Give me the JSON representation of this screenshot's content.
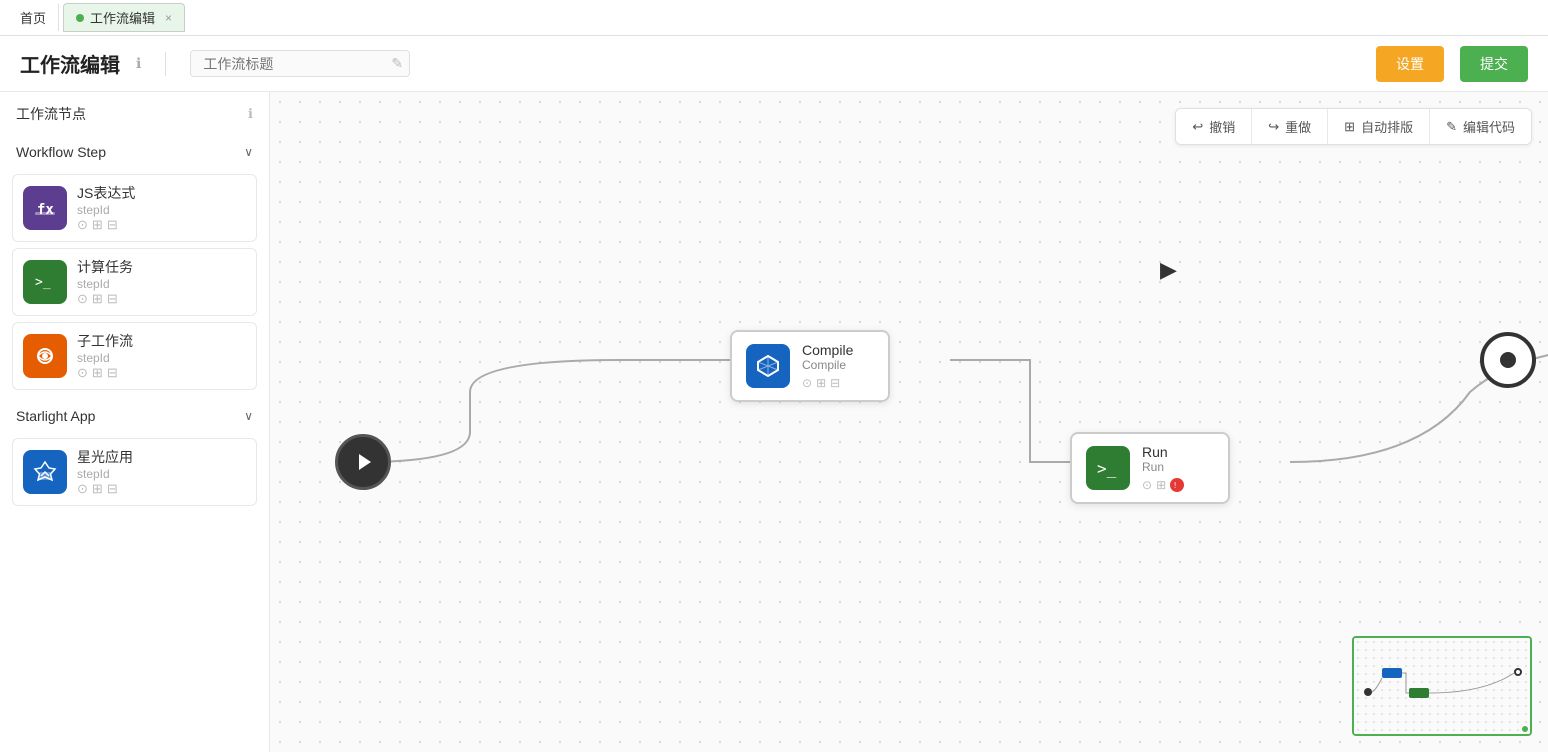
{
  "tabs": {
    "home": "首页",
    "active_tab": "工作流编辑",
    "close_icon": "×"
  },
  "header": {
    "title": "工作流编辑",
    "info_icon": "ℹ",
    "input_placeholder": "工作流标题",
    "edit_icon": "✎",
    "settings_btn": "设置",
    "submit_btn": "提交"
  },
  "sidebar": {
    "nodes_section": "工作流节点",
    "info_icon": "ℹ",
    "workflow_step_section": "Workflow Step",
    "starlight_app_section": "Starlight App",
    "items_workflow": [
      {
        "name": "JS表达式",
        "stepId": "stepId",
        "icon": "fx"
      },
      {
        "name": "计算任务",
        "stepId": "stepId",
        "icon": ">_"
      },
      {
        "name": "子工作流",
        "stepId": "stepId",
        "icon": "⊙"
      }
    ],
    "items_starlight": [
      {
        "name": "星光应用",
        "stepId": "stepId",
        "icon": "□"
      }
    ]
  },
  "toolbar": {
    "undo": "撤销",
    "redo": "重做",
    "auto_layout": "自动排版",
    "edit_code": "编辑代码"
  },
  "canvas": {
    "nodes": [
      {
        "id": "compile",
        "name": "Compile",
        "sub": "Compile",
        "type": "blue"
      },
      {
        "id": "run",
        "name": "Run",
        "sub": "Run",
        "type": "green"
      }
    ]
  }
}
